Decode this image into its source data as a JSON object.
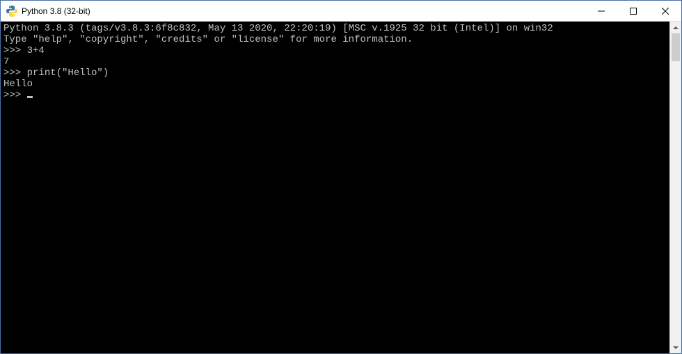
{
  "window": {
    "title": "Python 3.8 (32-bit)"
  },
  "console": {
    "banner_line1": "Python 3.8.3 (tags/v3.8.3:6f8c832, May 13 2020, 22:20:19) [MSC v.1925 32 bit (Intel)] on win32",
    "banner_line2": "Type \"help\", \"copyright\", \"credits\" or \"license\" for more information.",
    "prompt": ">>> ",
    "input1": "3+4",
    "output1": "7",
    "input2": "print(\"Hello\")",
    "output2": "Hello"
  }
}
